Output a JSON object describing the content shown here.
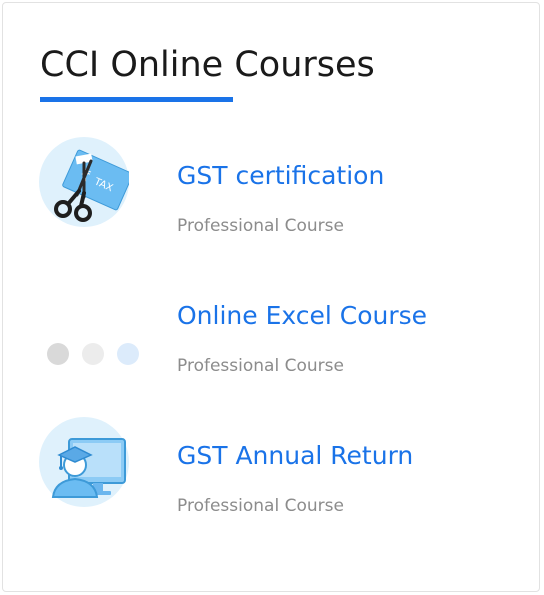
{
  "widget": {
    "title": "CCI Online Courses",
    "accent_color": "#1a73e8"
  },
  "courses": [
    {
      "name": "GST certification",
      "type": "Professional Course",
      "icon": "tax-scissors-icon"
    },
    {
      "name": "Online Excel Course",
      "type": "Professional Course",
      "icon": "loading-dots-icon"
    },
    {
      "name": "GST Annual Return",
      "type": "Professional Course",
      "icon": "graduate-computer-icon"
    }
  ]
}
